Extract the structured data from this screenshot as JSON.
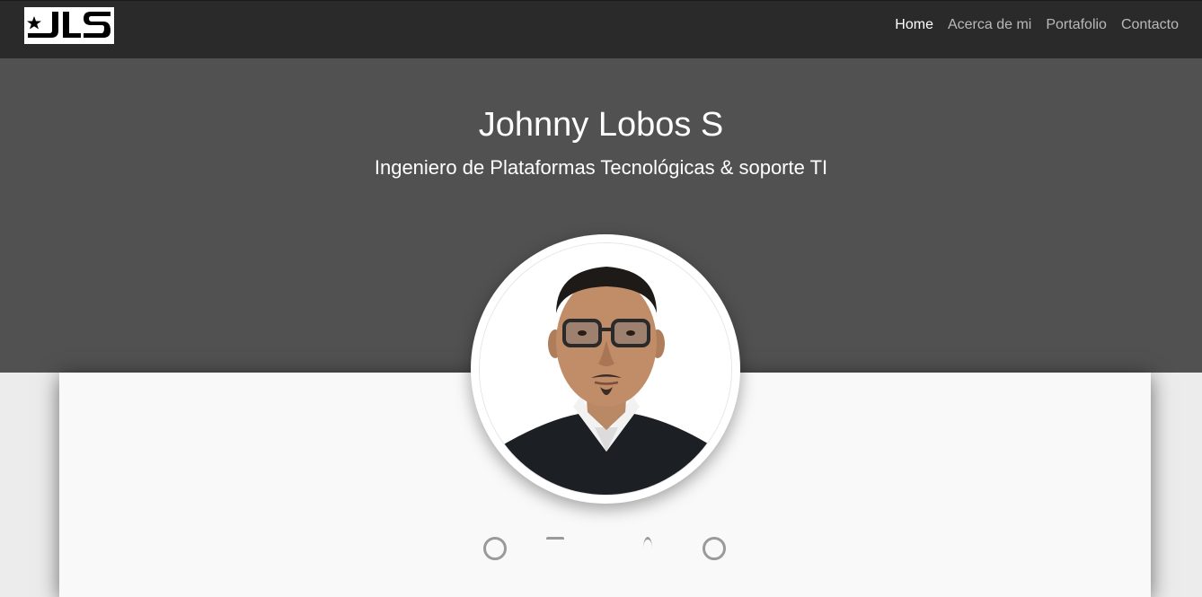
{
  "brand": {
    "logo_text": "JLS",
    "logo_icon": "star-icon"
  },
  "nav": {
    "items": [
      {
        "label": "Home",
        "active": true
      },
      {
        "label": "Acerca de mi",
        "active": false
      },
      {
        "label": "Portafolio",
        "active": false
      },
      {
        "label": "Contacto",
        "active": false
      }
    ]
  },
  "hero": {
    "title": "Johnny Lobos S",
    "subtitle": "Ingeniero de Plataformas Tecnológicas & soporte TI"
  },
  "profile": {
    "photo_icon": "profile-photo"
  },
  "colors": {
    "navbar": "#2a2a2a",
    "hero": "#515151",
    "nav_active": "#ffffff",
    "nav_inactive": "#b9b9b9",
    "card": "#f9f9f9"
  }
}
